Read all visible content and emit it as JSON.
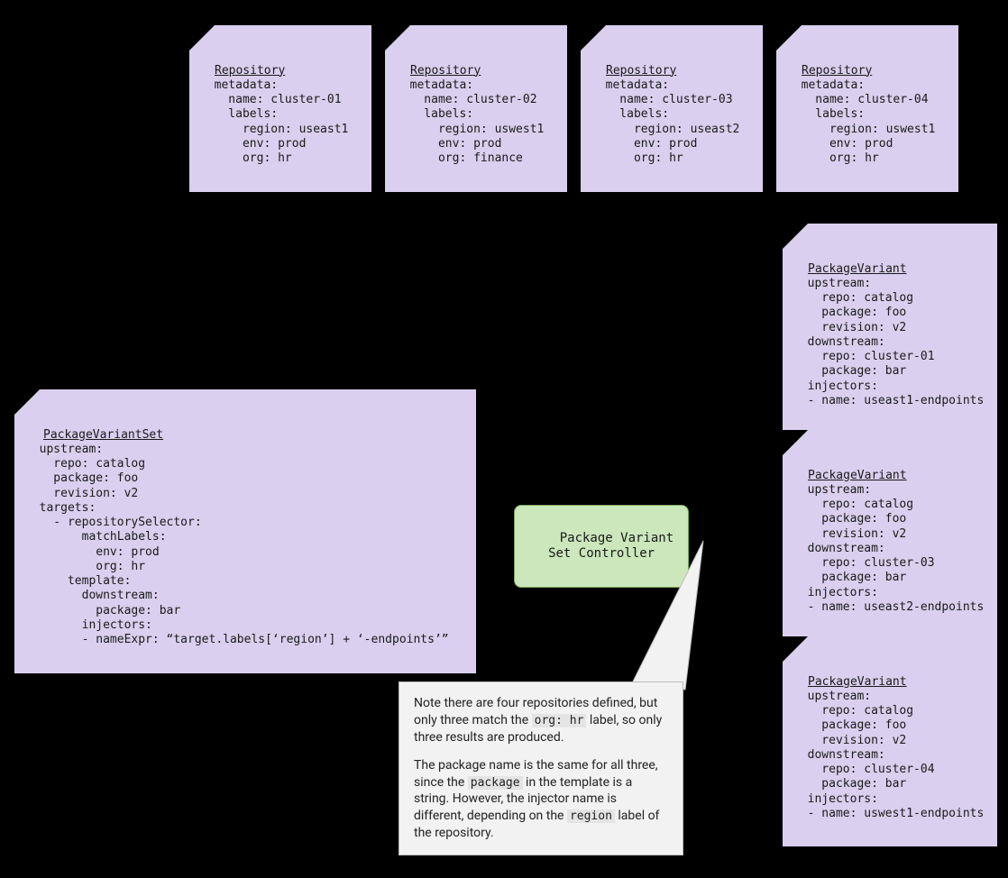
{
  "repositories": [
    {
      "title": "Repository",
      "body": "  metadata:\n    name: cluster-01\n    labels:\n      region: useast1\n      env: prod\n      org: hr"
    },
    {
      "title": "Repository",
      "body": "  metadata:\n    name: cluster-02\n    labels:\n      region: uswest1\n      env: prod\n      org: finance"
    },
    {
      "title": "Repository",
      "body": "  metadata:\n    name: cluster-03\n    labels:\n      region: useast2\n      env: prod\n      org: hr"
    },
    {
      "title": "Repository",
      "body": "  metadata:\n    name: cluster-04\n    labels:\n      region: uswest1\n      env: prod\n      org: hr"
    }
  ],
  "pvs": {
    "title": "PackageVariantSet",
    "body": "  upstream:\n    repo: catalog\n    package: foo\n    revision: v2\n  targets:\n    - repositorySelector:\n        matchLabels:\n          env: prod\n          org: hr\n      template:\n        downstream:\n          package: bar\n        injectors:\n        - nameExpr: “target.labels[‘region’] + ‘-endpoints’”"
  },
  "controller": {
    "label": "Package Variant\nSet Controller"
  },
  "variants": [
    {
      "title": "PackageVariant",
      "body": "  upstream:\n    repo: catalog\n    package: foo\n    revision: v2\n  downstream:\n    repo: cluster-01\n    package: bar\n  injectors:\n  - name: useast1-endpoints"
    },
    {
      "title": "PackageVariant",
      "body": "  upstream:\n    repo: catalog\n    package: foo\n    revision: v2\n  downstream:\n    repo: cluster-03\n    package: bar\n  injectors:\n  - name: useast2-endpoints"
    },
    {
      "title": "PackageVariant",
      "body": "  upstream:\n    repo: catalog\n    package: foo\n    revision: v2\n  downstream:\n    repo: cluster-04\n    package: bar\n  injectors:\n  - name: uswest1-endpoints"
    }
  ],
  "note": {
    "p1a": "Note there are four repositories defined, but only three match the ",
    "p1code": "org: hr",
    "p1b": " label, so only three results are produced.",
    "p2a": "The package name is the same for all three, since the ",
    "p2code1": "package",
    "p2b": " in the template is a string. However, the injector name is different, depending on the ",
    "p2code2": "region",
    "p2c": " label of the repository."
  }
}
